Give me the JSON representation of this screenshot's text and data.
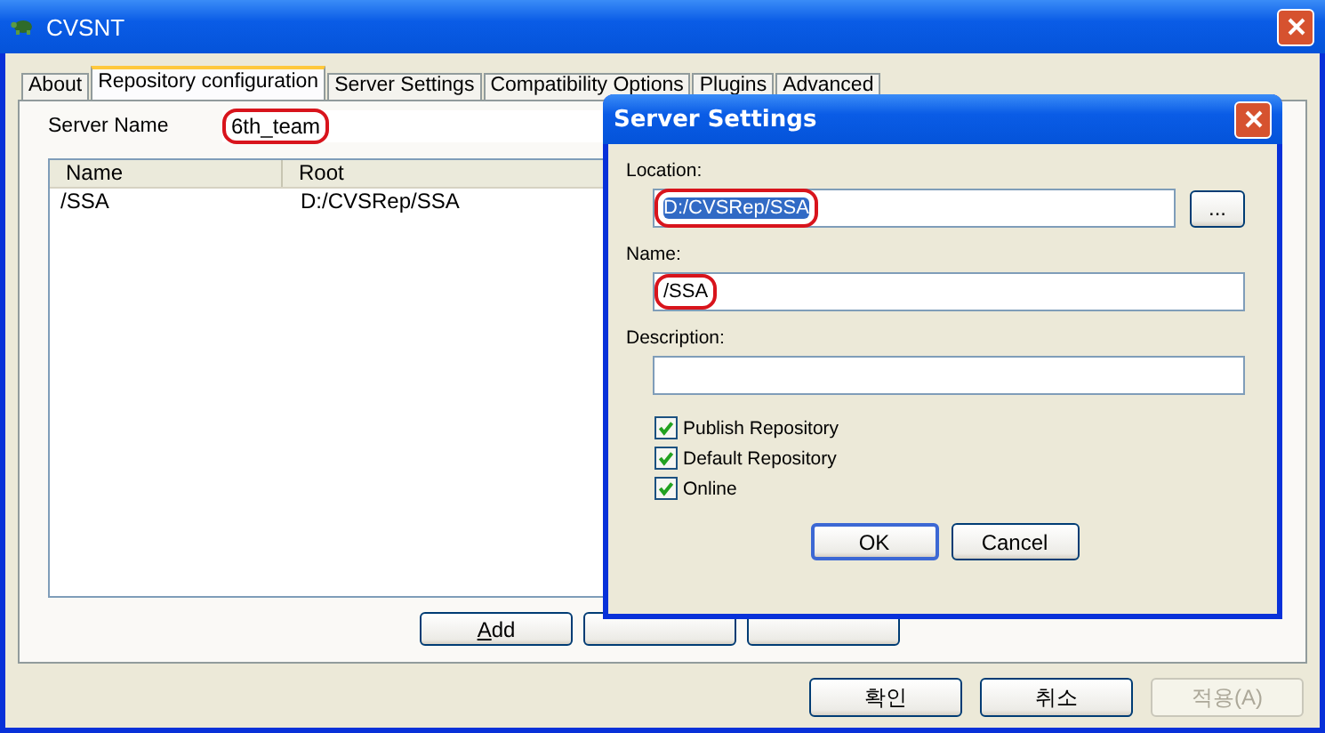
{
  "window": {
    "title": "CVSNT"
  },
  "tabs": [
    {
      "label": "About",
      "selected": false
    },
    {
      "label": "Repository configuration",
      "selected": true
    },
    {
      "label": "Server Settings",
      "selected": false
    },
    {
      "label": "Compatibility Options",
      "selected": false
    },
    {
      "label": "Plugins",
      "selected": false
    },
    {
      "label": "Advanced",
      "selected": false
    }
  ],
  "server_name": {
    "label": "Server Name",
    "value": "6th_team",
    "highlighted": true
  },
  "repositories": {
    "columns": [
      "Name",
      "Root"
    ],
    "rows": [
      {
        "cells": [
          "/SSA",
          "D:/CVSRep/SSA"
        ]
      }
    ]
  },
  "list_buttons": [
    {
      "label": "Add",
      "disabled": false
    },
    {
      "disabled": false
    },
    {
      "disabled": false
    }
  ],
  "footer_buttons": [
    {
      "label": "확인",
      "disabled": false
    },
    {
      "label": "취소",
      "disabled": false
    },
    {
      "label": "적용(A)",
      "disabled": true
    }
  ],
  "dialog": {
    "title": "Server Settings",
    "location": {
      "label": "Location:",
      "value": "D:/CVSRep/SSA",
      "text_selected": true,
      "highlighted": true,
      "browse": "..."
    },
    "name": {
      "label": "Name:",
      "value": "/SSA",
      "highlighted": true
    },
    "description": {
      "label": "Description:"
    },
    "options": [
      {
        "label": "Publish Repository",
        "checked": true
      },
      {
        "label": "Default Repository",
        "checked": true
      },
      {
        "label": "Online",
        "checked": true
      }
    ],
    "buttons": [
      {
        "label": "OK",
        "default": true
      },
      {
        "label": "Cancel",
        "default": false
      }
    ]
  }
}
